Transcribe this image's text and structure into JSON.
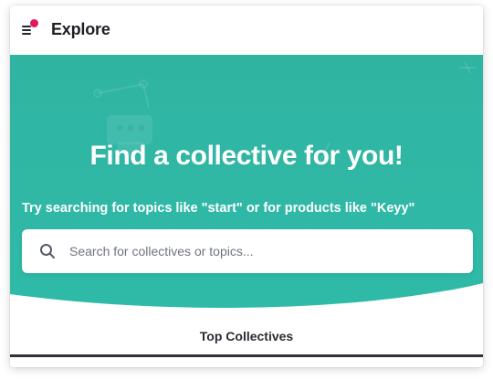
{
  "header": {
    "title": "Explore",
    "menu_icon": "hamburger-menu-icon",
    "notification_color": "#e0185c"
  },
  "hero": {
    "background_color": "#33b7a4",
    "heading": "Find a collective for you!",
    "subtitle": "Try searching for topics like \"start\" or for products like \"Keyy\""
  },
  "search": {
    "icon": "search-icon",
    "placeholder": "Search for collectives or topics...",
    "value": ""
  },
  "tabs": {
    "active_label": "Top Collectives"
  }
}
